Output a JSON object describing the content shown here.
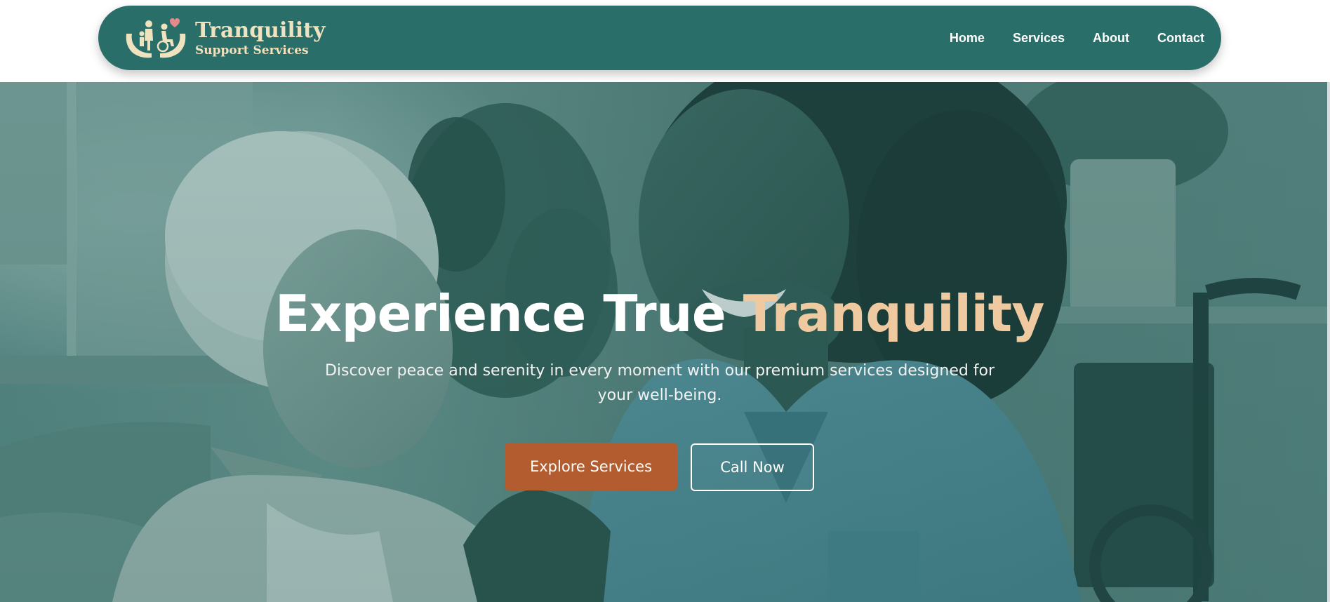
{
  "brand": {
    "title": "Tranquility",
    "subtitle": "Support Services",
    "logo_icon": "caring-hands-family-wheelchair-icon"
  },
  "nav": {
    "items": [
      {
        "label": "Home"
      },
      {
        "label": "Services"
      },
      {
        "label": "About"
      },
      {
        "label": "Contact"
      }
    ]
  },
  "hero": {
    "headline_main": "Experience True ",
    "headline_accent": "Tranquility",
    "subtext": "Discover peace and serenity in every moment with our premium services designed for your well-being.",
    "primary_button": "Explore Services",
    "secondary_button": "Call Now",
    "image": "caregiver-with-elderly-woman-photo"
  },
  "colors": {
    "nav_bg": "#2a6e6a",
    "accent": "#efc9a0",
    "primary_button": "#b25c2f",
    "logo_text": "#efe2bf"
  }
}
